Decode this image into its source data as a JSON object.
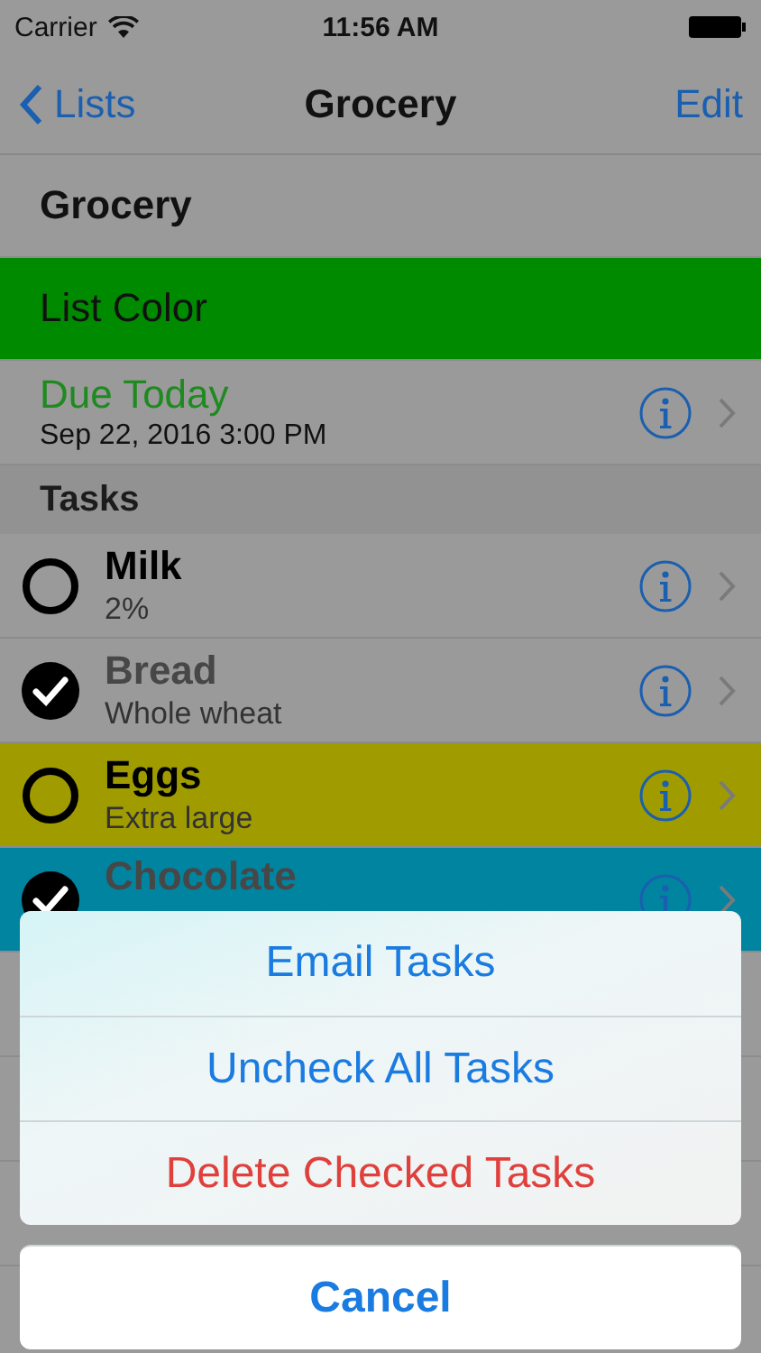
{
  "status_bar": {
    "carrier": "Carrier",
    "time": "11:56 AM"
  },
  "nav": {
    "back": "Lists",
    "title": "Grocery",
    "action": "Edit"
  },
  "list_name": "Grocery",
  "list_color": {
    "label": "List Color",
    "color": "#008a00"
  },
  "due": {
    "label": "Due Today",
    "date": "Sep 22, 2016 3:00 PM"
  },
  "section": "Tasks",
  "tasks": [
    {
      "name": "Milk",
      "note": "2%",
      "checked": false
    },
    {
      "name": "Bread",
      "note": "Whole wheat",
      "checked": true
    },
    {
      "name": "Eggs",
      "note": "Extra large",
      "checked": false,
      "color": "#a09c00"
    },
    {
      "name": "Chocolate",
      "checked": true,
      "color": "#0084a0"
    }
  ],
  "action_sheet": {
    "actions": [
      {
        "label": "Email Tasks",
        "kind": "normal"
      },
      {
        "label": "Uncheck All Tasks",
        "kind": "normal"
      },
      {
        "label": "Delete Checked Tasks",
        "kind": "destructive"
      }
    ],
    "cancel": "Cancel"
  }
}
